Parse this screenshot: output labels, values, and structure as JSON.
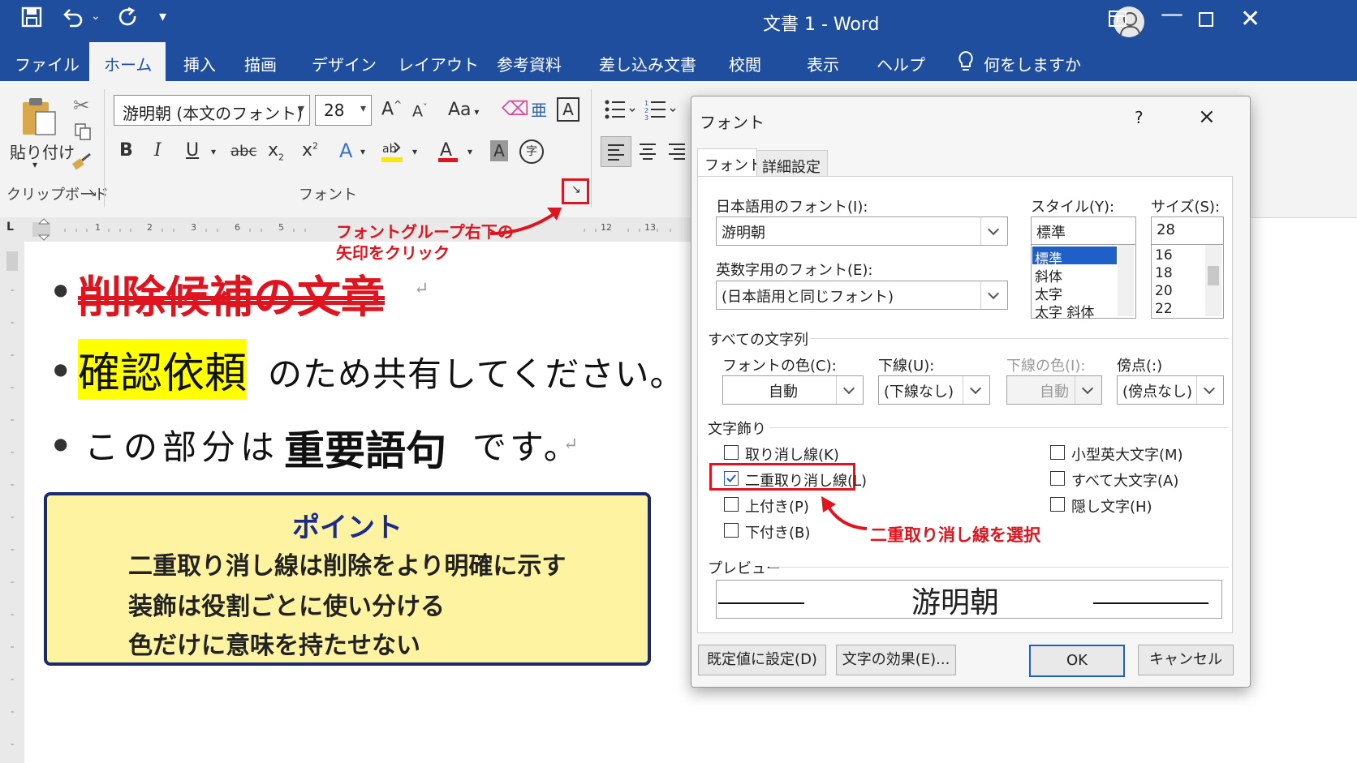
{
  "titlebar": {
    "title": "文書 1 - Word"
  },
  "tabs": [
    "ファイル",
    "ホーム",
    "挿入",
    "描画",
    "デザイン",
    "レイアウト",
    "参考資料",
    "差し込み文書",
    "校閲",
    "表示",
    "ヘルプ"
  ],
  "tell_me": "何をしますか",
  "ribbon": {
    "paste_label": "貼り付け",
    "font_name": "游明朝 (本文のフォント)",
    "font_size": "28",
    "group_clipboard": "クリップボード",
    "group_font": "フォント",
    "btn_bold": "B",
    "btn_italic": "I",
    "btn_underline": "U",
    "btn_strike": "abc",
    "btn_sub": "x",
    "btn_sub_mark": "2",
    "btn_sup": "x",
    "btn_sup_mark": "2",
    "btn_grow": "A",
    "btn_shrink": "A",
    "btn_case": "Aa"
  },
  "ruler_ticks": [
    "1",
    "2",
    "3",
    "6",
    "5",
    "12",
    "13"
  ],
  "document": {
    "line1": "削除候補の文章",
    "line2_highlight": "確認依頼",
    "line2_rest": "のため共有してください。",
    "line3_a": "この部分は",
    "line3_bold": "重要語句",
    "line3_b": "です。",
    "para_mark": "↵"
  },
  "point_box": {
    "title": "ポイント",
    "lines": [
      "二重取り消し線は削除をより明確に示す",
      "装飾は役割ごとに使い分ける",
      "色だけに意味を持たせない"
    ]
  },
  "annotations": {
    "arrow_click": [
      "フォントグループ右下の",
      "矢印をクリック"
    ],
    "select_double": "二重取り消し線を選択"
  },
  "dialog": {
    "title": "フォント",
    "help": "?",
    "close": "×",
    "tab_font": "フォント",
    "tab_advanced": "詳細設定",
    "jp_font_label": "日本語用のフォント(I):",
    "jp_font_value": "游明朝",
    "latin_font_label": "英数字用のフォント(E):",
    "latin_font_value": "(日本語用と同じフォント)",
    "style_label": "スタイル(Y):",
    "style_value": "標準",
    "style_options": [
      "標準",
      "斜体",
      "太字",
      "太字 斜体"
    ],
    "size_label": "サイズ(S):",
    "size_value": "28",
    "size_options": [
      "16",
      "18",
      "20",
      "22"
    ],
    "all_text_label": "すべての文字列",
    "font_color_label": "フォントの色(C):",
    "font_color_value": "自動",
    "underline_label": "下線(U):",
    "underline_value": "(下線なし)",
    "underline_color_label": "下線の色(I):",
    "underline_color_value": "自動",
    "emphasis_label": "傍点(:)",
    "emphasis_value": "(傍点なし)",
    "effects_label": "文字飾り",
    "effects": [
      {
        "label": "取り消し線(K)",
        "checked": false
      },
      {
        "label": "二重取り消し線(L)",
        "checked": true
      },
      {
        "label": "上付き(P)",
        "checked": false
      },
      {
        "label": "下付き(B)",
        "checked": false
      }
    ],
    "effects_right": [
      {
        "label": "小型英大文字(M)",
        "checked": false
      },
      {
        "label": "すべて大文字(A)",
        "checked": false
      },
      {
        "label": "隠し文字(H)",
        "checked": false
      }
    ],
    "preview_label": "プレビュー",
    "preview_text": "游明朝",
    "btn_default": "既定値に設定(D)",
    "btn_effects": "文字の効果(E)...",
    "btn_ok": "OK",
    "btn_cancel": "キャンセル"
  },
  "colors": {
    "titlebar": "#1f4e9e",
    "accent_red": "#e0141e",
    "highlight": "#ffff00",
    "point_bg": "#fdf3a1"
  }
}
